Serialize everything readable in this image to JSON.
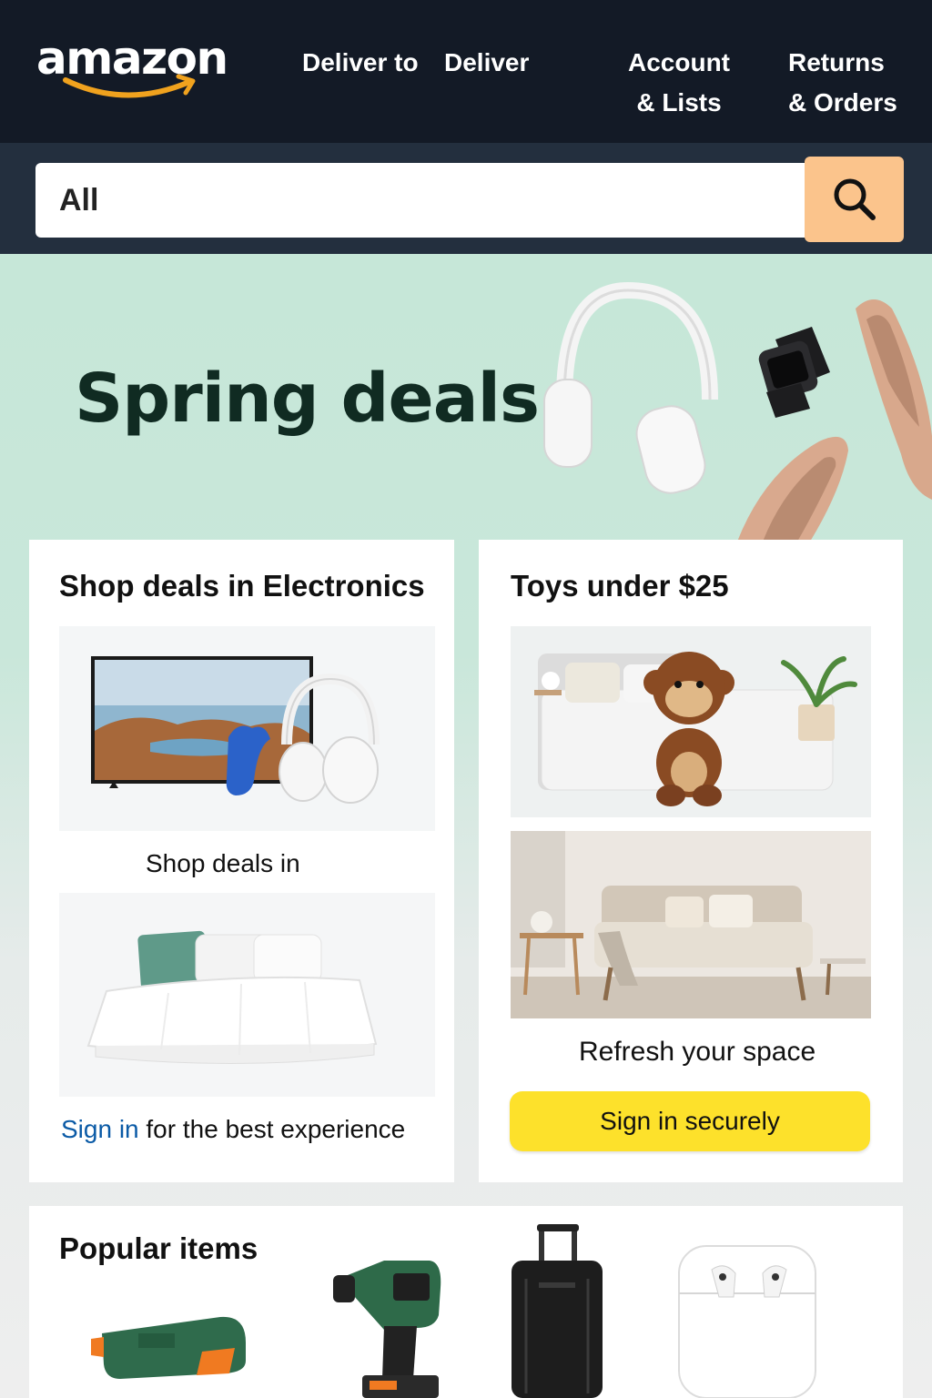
{
  "header": {
    "logo_text": "amazon",
    "deliver_to": "Deliver to",
    "deliver": "Deliver",
    "account_line1": "Account",
    "account_line2": "&  Lists",
    "returns_line1": "Returns",
    "returns_line2": "& Orders"
  },
  "search": {
    "scope": "All",
    "placeholder": "",
    "button_icon": "search-icon"
  },
  "hero": {
    "title": "Spring deals"
  },
  "cards": {
    "electronics": {
      "title": "Shop deals in Electronics",
      "caption": "Shop deals in",
      "signin_link": "Sign in",
      "signin_rest": " for the best experience"
    },
    "toys": {
      "title": "Toys under $25",
      "caption": "Refresh your space",
      "button": "Sign in securely"
    },
    "popular": {
      "title": "Popular items"
    }
  },
  "colors": {
    "header_bg": "#131a26",
    "search_bar_bg": "#232f3e",
    "search_button": "#fbc48c",
    "hero_bg": "#c6e7d8",
    "signin_button": "#fde12b",
    "link": "#0a5aa6",
    "logo_smile": "#f0a21e"
  }
}
